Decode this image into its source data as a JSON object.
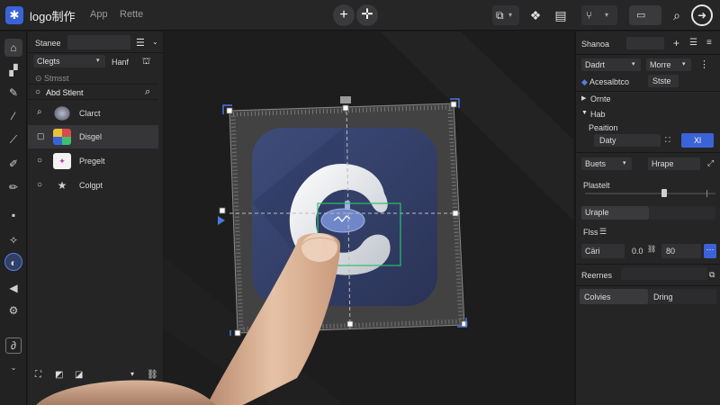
{
  "header": {
    "title": "logo制作",
    "menu": [
      "App",
      "Rette"
    ]
  },
  "layers_panel": {
    "tab_label": "Stanee",
    "filter_select": "Clegts",
    "filter_button": "Hanf",
    "section_label": "Stmsst",
    "group_label": "Abd Stlent",
    "items": [
      {
        "label": "Clarct",
        "icon": "eye-icon"
      },
      {
        "label": "Disgel",
        "icon": "square-icon"
      },
      {
        "label": "Pregelt",
        "icon": "eye-icon"
      },
      {
        "label": "Colgpt",
        "icon": "eye-icon"
      }
    ]
  },
  "props_panel": {
    "tab_label": "Shanoa",
    "dropdown_1": "Dadrt",
    "dropdown_2": "Morre",
    "accessibility_label": "Acesalbtco",
    "accessibility_value": "Stste",
    "section_ornte": "Ornte",
    "section_hab": "Hab",
    "position_label": "Peaition",
    "position_value": "Daty",
    "position_button": "Xl",
    "blends_label": "Buets",
    "hrape_label": "Hrape",
    "plastelt_label": "Plastelt",
    "uraple_label": "Uraple",
    "flss_label": "Flss",
    "car_label": "Cäri",
    "car_value_1": "0.0",
    "car_value_2": "80",
    "reernes_label": "Reernes",
    "colvies_label": "Colvies",
    "dring_label": "Dring"
  },
  "colors": {
    "accent": "#3b63d9",
    "selection_green": "#27c16a",
    "app_tile": "#3a4770"
  },
  "icons": {
    "app_logo": "gear-badge-icon",
    "add": "plus-icon",
    "move": "crosshair-icon",
    "share": "share-icon",
    "search": "search-icon",
    "go": "arrow-right-icon"
  }
}
